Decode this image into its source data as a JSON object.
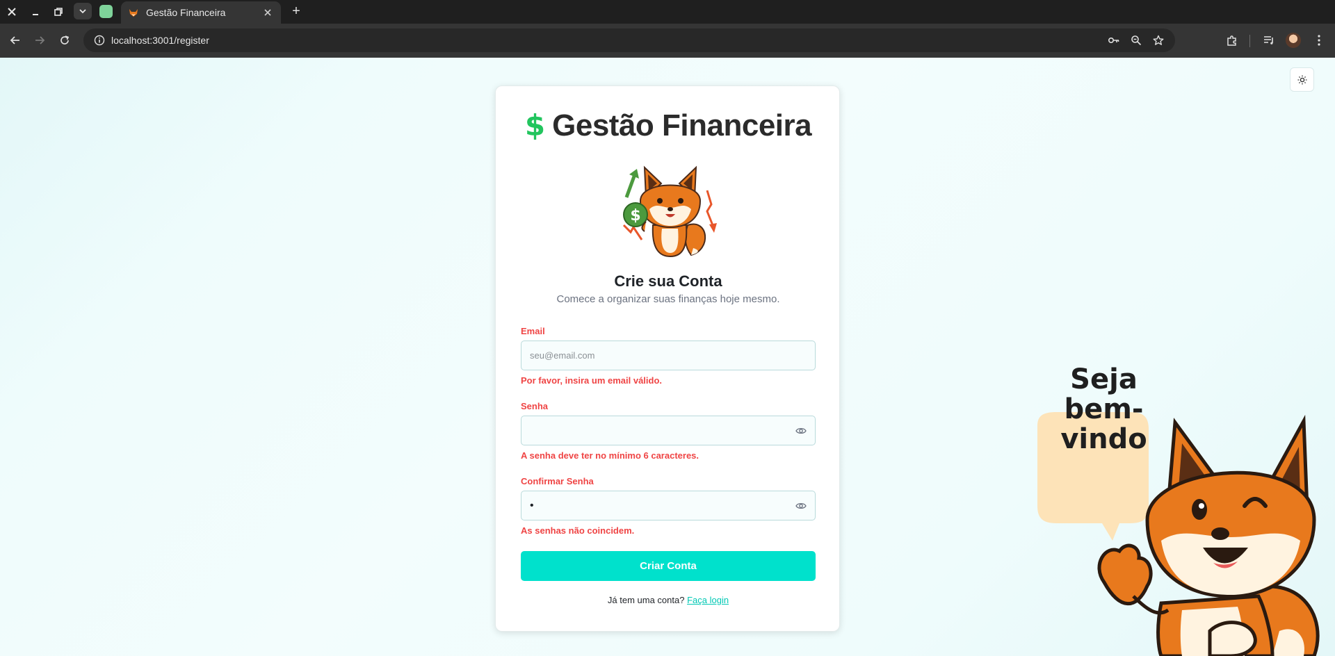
{
  "browser": {
    "tab_title": "Gestão Financeira",
    "url": "localhost:3001/register"
  },
  "page": {
    "brand": {
      "icon": "dollar-icon",
      "symbol": "$",
      "name": "Gestão Financeira",
      "accent_color": "#22c55e"
    },
    "heading": "Crie sua Conta",
    "subheading": "Comece a organizar suas finanças hoje mesmo.",
    "form": {
      "email": {
        "label": "Email",
        "placeholder": "seu@email.com",
        "value": "",
        "error": "Por favor, insira um email válido."
      },
      "password": {
        "label": "Senha",
        "value": "",
        "error": "A senha deve ter no mínimo 6 caracteres."
      },
      "confirm_password": {
        "label": "Confirmar Senha",
        "value": "•",
        "error": "As senhas não coincidem."
      },
      "submit_label": "Criar Conta",
      "error_color": "#ef4444",
      "button_color": "#00e1cc"
    },
    "login_prompt": "Já tem uma conta?",
    "login_link": "Faça login",
    "welcome_bubble": {
      "line1": "Seja",
      "line2": "bem-",
      "line3": "vindo"
    }
  }
}
